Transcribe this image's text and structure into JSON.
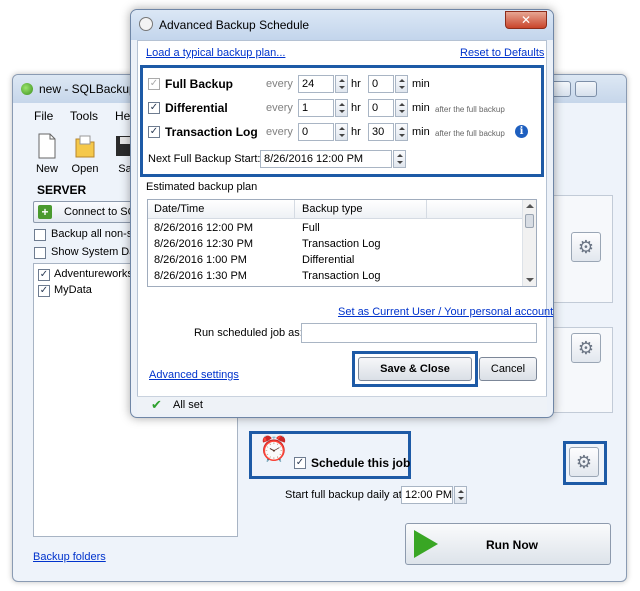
{
  "main_window": {
    "title": "new - SQLBackup...",
    "menu": [
      "File",
      "Tools",
      "He"
    ],
    "toolbar": [
      {
        "label": "New",
        "icon": "new-icon"
      },
      {
        "label": "Open",
        "icon": "open-folder-icon"
      },
      {
        "label": "Sa",
        "icon": "save-icon"
      }
    ],
    "server_header": "SERVER",
    "connect_label": "Connect to SQ",
    "backup_all_label": "Backup all non-sy",
    "show_system_label": "Show System Da",
    "databases": [
      {
        "name": "Adventureworks",
        "checked": true
      },
      {
        "name": "MyData",
        "checked": true
      }
    ],
    "backup_folders": "Backup folders",
    "schedule_job_label": "Schedule this job",
    "start_daily_label": "Start full backup daily at:",
    "start_daily_time": "12:00 PM",
    "run_now": "Run Now"
  },
  "dialog": {
    "title": "Advanced Backup Schedule",
    "close_glyph": "✕",
    "load_plan_link": "Load a typical backup plan...",
    "reset_link": "Reset to Defaults",
    "every_label": "every",
    "hr_label": "hr",
    "min_label": "min",
    "after_full_note": "after the full backup",
    "rows": [
      {
        "label": "Full Backup",
        "hours": "24",
        "minutes": "0",
        "checked": true,
        "enabled": false
      },
      {
        "label": "Differential",
        "hours": "1",
        "minutes": "0",
        "checked": true,
        "enabled": true
      },
      {
        "label": "Transaction Log",
        "hours": "0",
        "minutes": "30",
        "checked": true,
        "enabled": true
      }
    ],
    "next_start_label": "Next Full Backup Start:",
    "next_start_value": "8/26/2016 12:00 PM",
    "plan_title": "Estimated backup plan",
    "plan_headers": [
      "Date/Time",
      "Backup type"
    ],
    "plan_rows": [
      {
        "datetime": "8/26/2016 12:00 PM",
        "type": "Full"
      },
      {
        "datetime": "8/26/2016 12:30 PM",
        "type": "Transaction Log"
      },
      {
        "datetime": "8/26/2016 1:00 PM",
        "type": "Differential"
      },
      {
        "datetime": "8/26/2016 1:30 PM",
        "type": "Transaction Log"
      }
    ],
    "set_user_link": "Set as Current User / Your personal account",
    "run_as_label": "Run scheduled job as:",
    "run_as_value": "",
    "advanced_link": "Advanced settings",
    "save_close": "Save & Close",
    "cancel": "Cancel",
    "status": "All set"
  },
  "colors": {
    "highlight_frame": "#1d5aa6",
    "link": "#0033cc",
    "ok_green": "#2ea12e"
  }
}
